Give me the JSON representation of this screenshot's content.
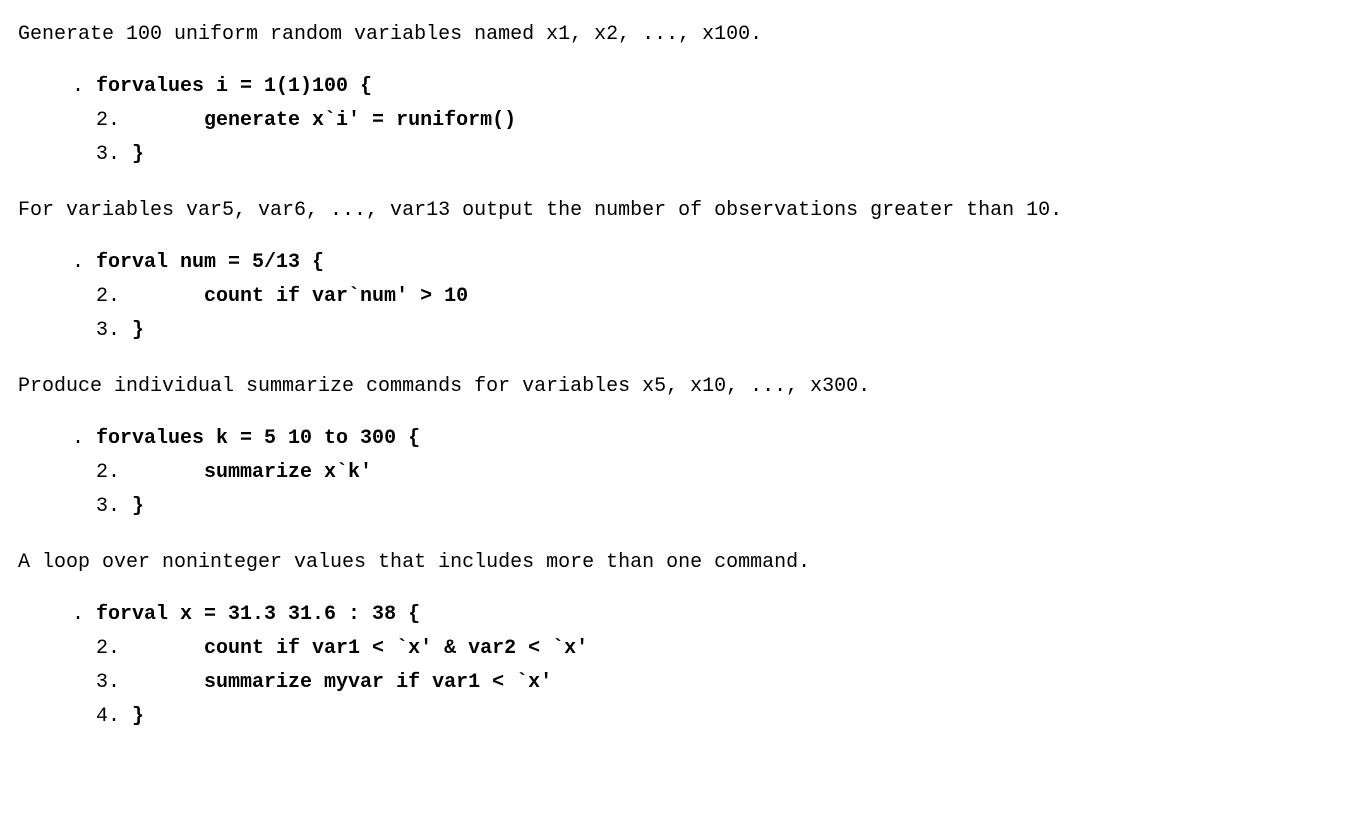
{
  "sections": [
    {
      "desc": "Generate 100 uniform random variables named x1, x2, ..., x100.",
      "lines": [
        {
          "prefix": ". ",
          "bold": "forvalues i = 1(1)100 {"
        },
        {
          "prefix": "  2.       ",
          "bold": "generate x`i' = runiform()"
        },
        {
          "prefix": "  3. ",
          "bold": "}"
        }
      ]
    },
    {
      "desc": "For variables var5, var6, ..., var13 output the number of observations greater than 10.",
      "lines": [
        {
          "prefix": ". ",
          "bold": "forval num = 5/13 {"
        },
        {
          "prefix": "  2.       ",
          "bold": "count if var`num' > 10"
        },
        {
          "prefix": "  3. ",
          "bold": "}"
        }
      ]
    },
    {
      "desc": "Produce individual summarize commands for variables x5, x10, ..., x300.",
      "lines": [
        {
          "prefix": ". ",
          "bold": "forvalues k = 5 10 to 300 {"
        },
        {
          "prefix": "  2.       ",
          "bold": "summarize x`k'"
        },
        {
          "prefix": "  3. ",
          "bold": "}"
        }
      ]
    },
    {
      "desc": "A loop over noninteger values that includes more than one command.",
      "lines": [
        {
          "prefix": ". ",
          "bold": "forval x = 31.3 31.6 : 38 {"
        },
        {
          "prefix": "  2.       ",
          "bold": "count if var1 < `x' & var2 < `x'"
        },
        {
          "prefix": "  3.       ",
          "bold": "summarize myvar if var1 < `x'"
        },
        {
          "prefix": "  4. ",
          "bold": "}"
        }
      ]
    }
  ]
}
